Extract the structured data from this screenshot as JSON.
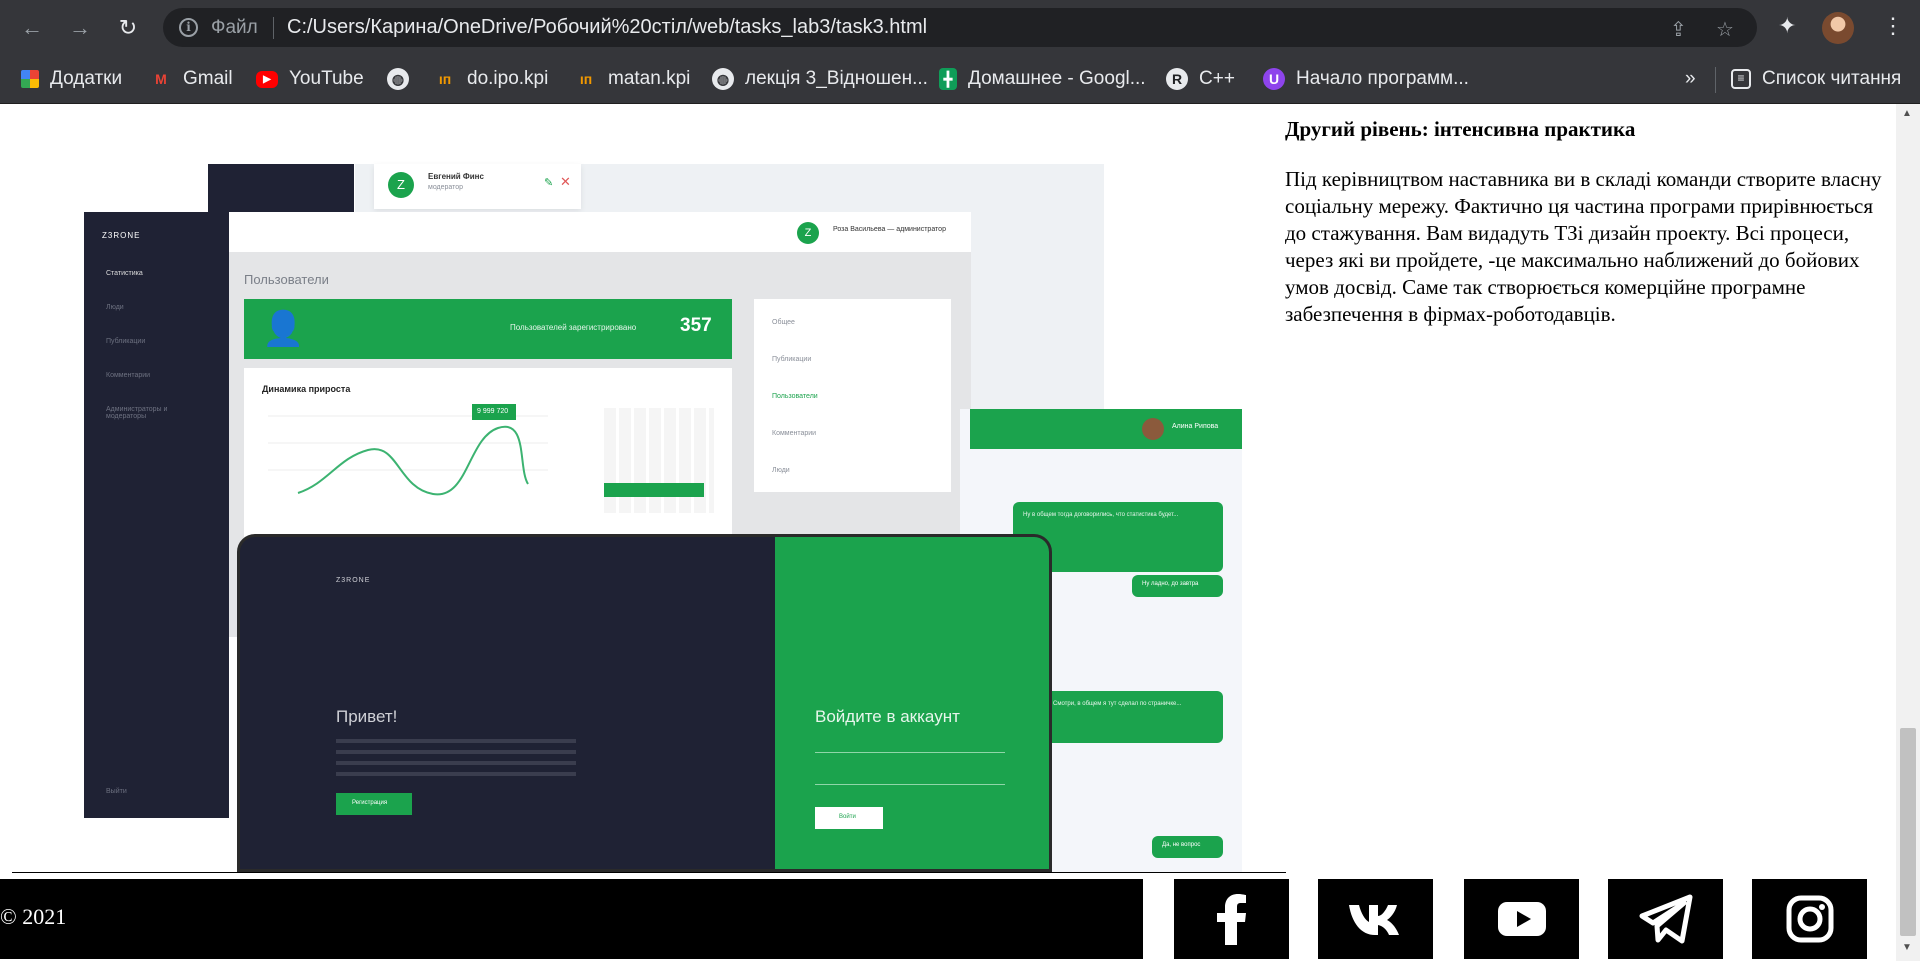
{
  "browser": {
    "file_label": "Файл",
    "url": "C:/Users/Карина/OneDrive/Робочий%20стіл/web/tasks_lab3/task3.html",
    "bookmarks": [
      {
        "label": "Додатки",
        "icon": "apps-grid-icon"
      },
      {
        "label": "Gmail",
        "icon": "gmail-icon"
      },
      {
        "label": "YouTube",
        "icon": "youtube-icon"
      },
      {
        "label": "",
        "icon": "globe-icon"
      },
      {
        "label": "do.ipo.kpi",
        "icon": "kpi-icon"
      },
      {
        "label": "matan.kpi",
        "icon": "kpi-icon"
      },
      {
        "label": "лекція 3_Відношен...",
        "icon": "globe-icon"
      },
      {
        "label": "Домашнее - Googl...",
        "icon": "google-sheets-icon"
      },
      {
        "label": "C++",
        "icon": "r-circle-icon"
      },
      {
        "label": "Начало программ...",
        "icon": "purple-u-icon"
      }
    ],
    "more": "»",
    "reading_list": "Список читання"
  },
  "mockup": {
    "logo": "Z3RONE",
    "user_name": "Евгений Финс",
    "user_role": "модератор",
    "admin": "Роза Васильева — администратор",
    "page_title": "Пользователи",
    "registered_label": "Пользователей зарегистрировано",
    "registered_count": "357",
    "growth_title": "Динамика прироста",
    "peak_label": "9 999 720",
    "sidebar": [
      "Статистика",
      "Люди",
      "Публикации",
      "Комментарии",
      "Администраторы и модераторы"
    ],
    "logout": "Выйти",
    "menu": [
      "Общее",
      "Публикации",
      "Пользователи",
      "Комментарии",
      "Люди"
    ],
    "chat_user": "Алина Рипова",
    "chat_msgs": [
      "Ну в общем тогда договорились, что статистика будет...",
      "Ну ладно, до завтра",
      "Смотри, в общем я тут сделал по страничке...",
      "Да, не вопрос"
    ],
    "hello": "Привет!",
    "login_title": "Войдите в аккаунт",
    "register_btn": "Регистрация",
    "login_btn": "Войти"
  },
  "content": {
    "heading": "Другий рівень: інтенсивна практика",
    "body": "Під керівництвом наставника ви в складі команди створите власну соціальну мережу. Фактично ця частина програми прирівнюється до стажування. Вам видадуть ТЗі дизайн проекту. Всі процеси, через які ви пройдете, -це максимально наближений до бойових умов досвід. Саме так створюється комерційне програмне забезпечення в фірмах-роботодавців."
  },
  "footer": {
    "copyright": "© 2021",
    "social": [
      "facebook-icon",
      "vk-icon",
      "youtube-icon",
      "telegram-icon",
      "instagram-icon"
    ]
  },
  "colors": {
    "accent": "#1ba34d",
    "dark": "#1f2234",
    "chrome": "#35363a"
  }
}
